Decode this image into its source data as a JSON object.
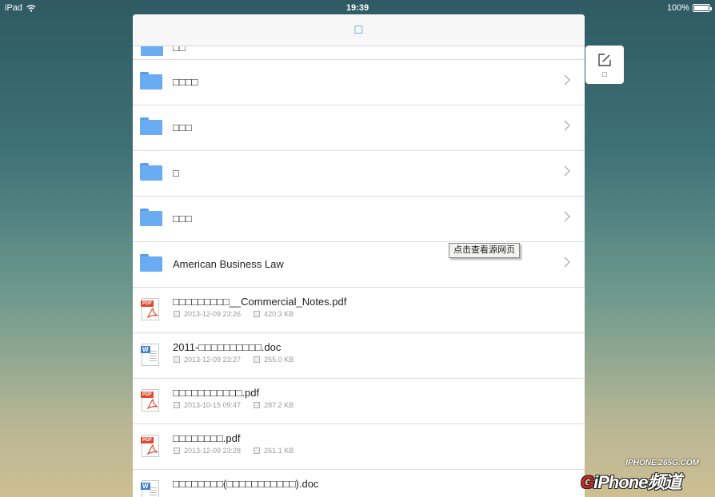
{
  "status_bar": {
    "device": "iPad",
    "time": "19:39",
    "battery": "100%",
    "battery_level": 1.0
  },
  "header": {
    "title": "□"
  },
  "side_button": {
    "label": "□",
    "icon": "edit-icon"
  },
  "partial_top_row": {
    "label": "□□"
  },
  "folders": [
    {
      "name": "□□□□"
    },
    {
      "name": "□□□"
    },
    {
      "name": "□"
    },
    {
      "name": "□□□"
    },
    {
      "name": "American Business Law"
    }
  ],
  "files": [
    {
      "name": "□□□□□□□□□__Commercial_Notes.pdf",
      "type": "pdf",
      "date": "2013-12-09 23:26",
      "size": "420.3 KB"
    },
    {
      "name": "2011-□□□□□□□□□□.doc",
      "type": "word",
      "date": "2013-12-09 23:27",
      "size": "255.0 KB"
    },
    {
      "name": "□□□□□□□□□□□.pdf",
      "type": "pdf",
      "date": "2013-10-15 09:47",
      "size": "287.2 KB"
    },
    {
      "name": "□□□□□□□□.pdf",
      "type": "pdf",
      "date": "2013-12-09 23:28",
      "size": "261.1 KB"
    },
    {
      "name": "□□□□□□□□(□□□□□□□□□□□).doc",
      "type": "word"
    }
  ],
  "tooltip": {
    "text": "点击查看源网页"
  },
  "watermark": {
    "url": "IPHONE.265G.COM",
    "brand_g": "G",
    "brand_rest": "iPhone频道"
  },
  "colors": {
    "folder": "#6aacf2",
    "accent": "#3a8fd9",
    "pdf_badge": "#e04b2f",
    "word_badge": "#3f7fd0"
  },
  "badges": {
    "pdf": "PDF",
    "word": "W"
  }
}
